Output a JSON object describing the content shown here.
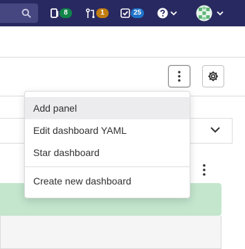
{
  "topbar": {
    "search_icon": "search-icon",
    "issues": {
      "icon": "issues-icon",
      "count": "8",
      "color": "#108548"
    },
    "merge_requests": {
      "icon": "merge-request-icon",
      "count": "1",
      "color": "#c17d10"
    },
    "todos": {
      "icon": "todo-icon",
      "count": "25",
      "color": "#1f75cb"
    },
    "help": {
      "icon": "help-icon"
    },
    "user": {
      "icon": "avatar"
    }
  },
  "toolbar": {
    "actions_icon": "kebab-icon",
    "settings_icon": "gear-icon"
  },
  "dashboard_menu": {
    "items": [
      {
        "label": "Add panel"
      },
      {
        "label": "Edit dashboard YAML"
      },
      {
        "label": "Star dashboard"
      },
      {
        "label": "Create new dashboard"
      }
    ]
  },
  "colors": {
    "topbar_bg": "#292961",
    "panel_green": "#c3e6cd"
  }
}
